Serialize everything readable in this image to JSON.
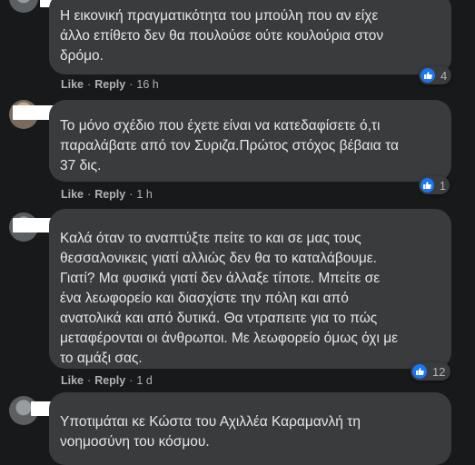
{
  "comments": [
    {
      "text_lines": [
        "Η εικονική πραγματικότητα του μπούλη που αν είχε",
        "άλλο επίθετο δεν θα πουλούσε ούτε κουλούρια στον",
        "δρόμο."
      ],
      "like": "Like",
      "reply": "Reply",
      "time": "16 h",
      "reactions": "4",
      "reaction_icon": "like-icon"
    },
    {
      "text_lines": [
        "Το μόνο σχέδιο που έχετε είναι να κατεδαφίσετε ό,τι",
        "παραλάβατε από τον Συριζα.Πρώτος στόχος βέβαια τα",
        "37 δις."
      ],
      "like": "Like",
      "reply": "Reply",
      "time": "1 h",
      "reactions": "1",
      "reaction_icon": "like-icon"
    },
    {
      "text_lines": [
        "Καλά όταν το αναπτύξτε πείτε το και σε μας τους",
        "θεσσαλονικεις γιατί αλλιώς δεν θα το καταλάβουμε.",
        "Γιατί? Μα φυσικά γιατί δεν άλλαξε τίποτε. Μπείτε σε",
        "ένα λεωφορείο και διασχίστε την πόλη και από",
        "ανατολικά και από δυτικά. Θα ντραπειτε για το πώς",
        "μεταφέρονται οι άνθρωποι. Με λεωφορείο όμως όχι με",
        "το αμάξι σας."
      ],
      "like": "Like",
      "reply": "Reply",
      "time": "1 d",
      "reactions": "12",
      "reaction_icon": "like-icon"
    },
    {
      "text_lines": [
        "Υποτιμάται κε Κώστα του Αχιλλέα Καραμανλή τη",
        "νοημοσύνη του κόσμου."
      ]
    }
  ],
  "colors": {
    "background": "#18191a",
    "bubble": "#3a3b3c",
    "text": "#e4e6eb",
    "meta": "#b0b3b8",
    "like_blue": "#1877f2",
    "redaction": "#ffffff"
  }
}
